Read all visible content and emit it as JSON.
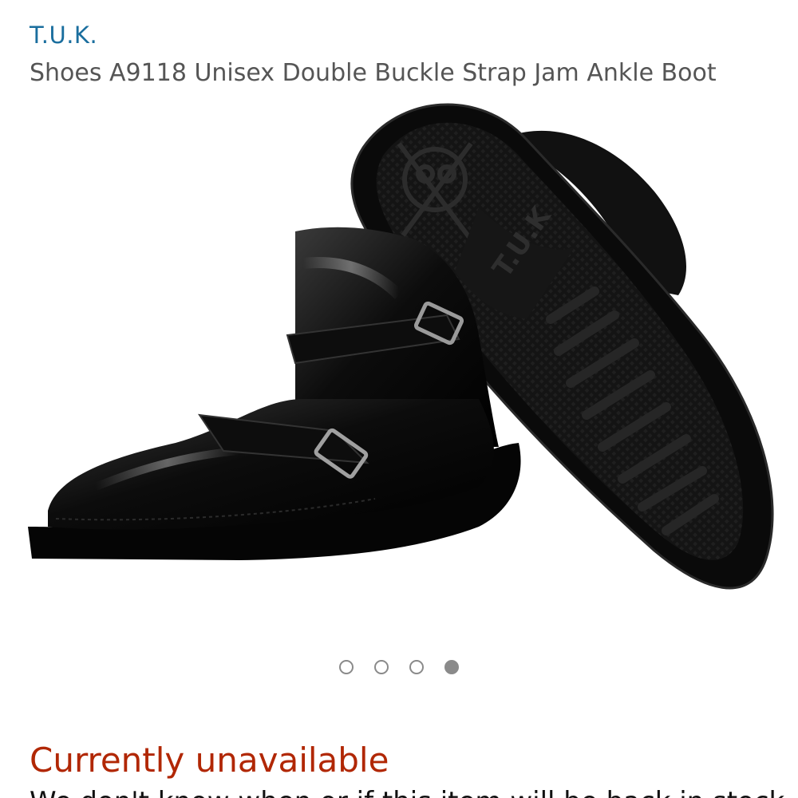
{
  "product": {
    "brand": "T.U.K.",
    "title": "Shoes A9118 Unisex Double Buckle Strap Jam Ankle Boot",
    "image": {
      "description_icon": "product-photo",
      "sole_logo": "T.U.K"
    }
  },
  "carousel": {
    "total": 4,
    "active_index": 3
  },
  "availability": {
    "status": "Currently unavailable",
    "status_color": "#b12704",
    "note": "We don't know when or if this item will be back in stock."
  }
}
